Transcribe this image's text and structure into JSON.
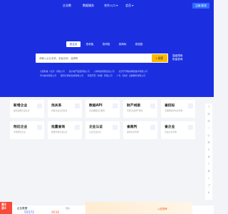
{
  "nav": {
    "items": [
      "企业数",
      "数据服务",
      "合作入口 ▾",
      "会员 ▾"
    ],
    "login_label": "注册/登录"
  },
  "search": {
    "tabs": [
      "查企业",
      "查老板",
      "查风险",
      "查商标",
      "查招投"
    ],
    "placeholder": "请输入企业名称、老板名称、品牌等",
    "button_label": "搜索",
    "side_links": [
      "高级",
      "搜索",
      "批量",
      "查询"
    ]
  },
  "hot_searches": [
    [
      "九阳科技（北京）有限公司",
      "恒大地产集团有限公司",
      "小米科技有限责任公司",
      "北京字节跳动网络技术有限公司"
    ],
    [
      "华为技术有限公司",
      "腾讯计算机系统有限公司",
      "阿里巴巴（中国）有限公司",
      "广东（深圳）证券服务有限公司"
    ]
  ],
  "cards": [
    [
      {
        "title": "新增企业",
        "sub": "最新注册企业信息"
      },
      {
        "title": "找关系",
        "sub": "查看企业之间关系"
      },
      {
        "title": "数据API",
        "sub": "企业数据接口服务"
      },
      {
        "title": "财产线索",
        "sub": "查找企业财产线索"
      },
      {
        "title": "查招标",
        "sub": "全国招投标信息查询"
      }
    ],
    [
      {
        "title": "附近企业",
        "sub": "查找附近企业"
      },
      {
        "title": "批量查询",
        "sub": "批量查询企业信息"
      },
      {
        "title": "企业认证",
        "sub": "认证企业信息"
      },
      {
        "title": "查裁判",
        "sub": "裁判文书查询"
      },
      {
        "title": "查企业",
        "sub": "企业信息查询"
      }
    ]
  ],
  "right_bar": [
    "↑",
    "☏",
    "✉",
    "♡",
    "◎",
    "☰",
    "✎",
    "⬇",
    "?",
    "⚙",
    "☆",
    "⤴",
    "✕"
  ],
  "bottom": {
    "badge": "第3\n波2",
    "title": "企业数据",
    "more": "更多",
    "num1": "55572",
    "num2": "9036",
    "promo": "入驻热榜"
  },
  "colors": {
    "brand": "#1b2fe0",
    "accent": "#ffb800",
    "badge": "#f74b3a"
  }
}
